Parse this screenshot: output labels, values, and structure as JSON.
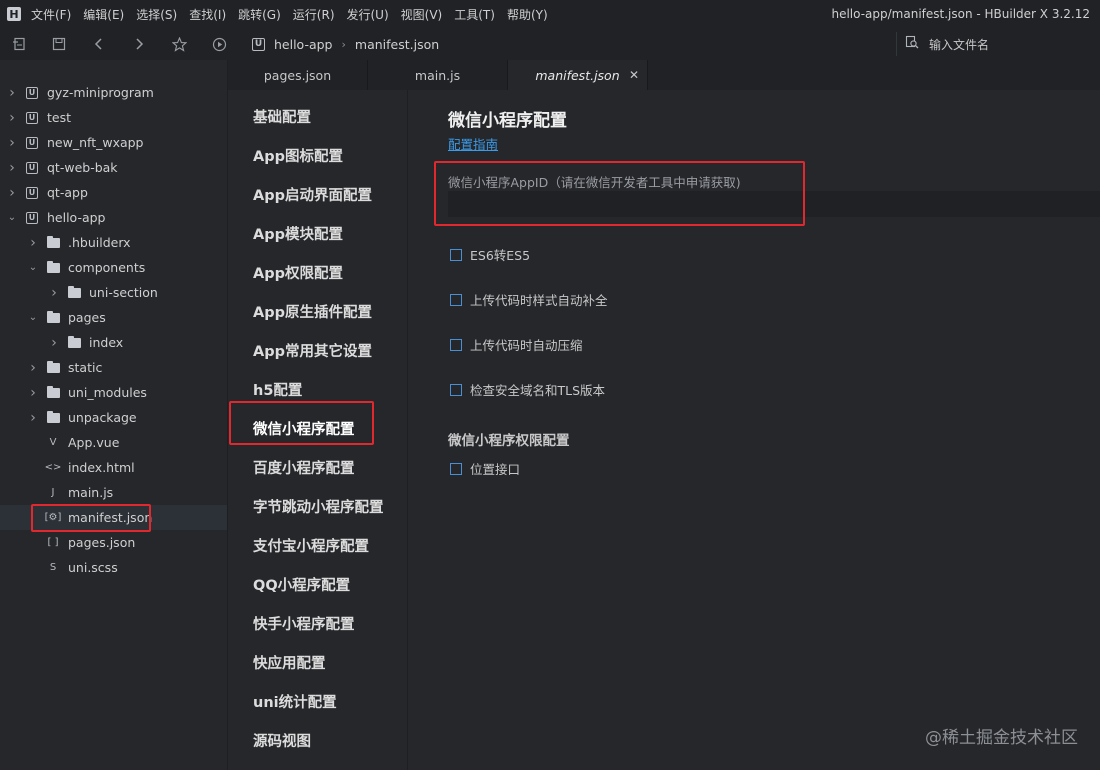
{
  "app": {
    "logo_letter": "H",
    "window_title": "hello-app/manifest.json - HBuilder X 3.2.12"
  },
  "menu": [
    "文件(F)",
    "编辑(E)",
    "选择(S)",
    "查找(I)",
    "跳转(G)",
    "运行(R)",
    "发行(U)",
    "视图(V)",
    "工具(T)",
    "帮助(Y)"
  ],
  "toolbar": {
    "breadcrumb": [
      "hello-app",
      "manifest.json"
    ],
    "project_badge": "U",
    "search_placeholder": "输入文件名"
  },
  "tree": [
    {
      "label": "gyz-miniprogram",
      "type": "project",
      "level": 0,
      "expanded": false
    },
    {
      "label": "test",
      "type": "project",
      "level": 0,
      "expanded": false
    },
    {
      "label": "new_nft_wxapp",
      "type": "project",
      "level": 0,
      "expanded": false
    },
    {
      "label": "qt-web-bak",
      "type": "project",
      "level": 0,
      "expanded": false
    },
    {
      "label": "qt-app",
      "type": "project",
      "level": 0,
      "expanded": false
    },
    {
      "label": "hello-app",
      "type": "project",
      "level": 0,
      "expanded": true
    },
    {
      "label": ".hbuilderx",
      "type": "folder",
      "level": 1,
      "expanded": false
    },
    {
      "label": "components",
      "type": "folder",
      "level": 1,
      "expanded": true
    },
    {
      "label": "uni-section",
      "type": "folder",
      "level": 2,
      "expanded": false
    },
    {
      "label": "pages",
      "type": "folder",
      "level": 1,
      "expanded": true
    },
    {
      "label": "index",
      "type": "folder",
      "level": 2,
      "expanded": false
    },
    {
      "label": "static",
      "type": "folder",
      "level": 1,
      "expanded": false
    },
    {
      "label": "uni_modules",
      "type": "folder",
      "level": 1,
      "expanded": false
    },
    {
      "label": "unpackage",
      "type": "folder",
      "level": 1,
      "expanded": false
    },
    {
      "label": "App.vue",
      "type": "vue",
      "level": 1,
      "expanded": null
    },
    {
      "label": "index.html",
      "type": "html",
      "level": 1,
      "expanded": null
    },
    {
      "label": "main.js",
      "type": "js",
      "level": 1,
      "expanded": null
    },
    {
      "label": "manifest.json",
      "type": "manifest",
      "level": 1,
      "expanded": null,
      "selected": true
    },
    {
      "label": "pages.json",
      "type": "json",
      "level": 1,
      "expanded": null
    },
    {
      "label": "uni.scss",
      "type": "scss",
      "level": 1,
      "expanded": null
    }
  ],
  "tabs": [
    {
      "label": "pages.json",
      "active": false
    },
    {
      "label": "main.js",
      "active": false
    },
    {
      "label": "manifest.json",
      "active": true
    }
  ],
  "config_nav": [
    "基础配置",
    "App图标配置",
    "App启动界面配置",
    "App模块配置",
    "App权限配置",
    "App原生插件配置",
    "App常用其它设置",
    "h5配置",
    "微信小程序配置",
    "百度小程序配置",
    "字节跳动小程序配置",
    "支付宝小程序配置",
    "QQ小程序配置",
    "快手小程序配置",
    "快应用配置",
    "uni统计配置",
    "源码视图"
  ],
  "config_nav_active_index": 8,
  "main": {
    "title": "微信小程序配置",
    "guide_link": "配置指南",
    "appid_label": "微信小程序AppID（请在微信开发者工具中申请获取)",
    "appid_value": "",
    "options": [
      "ES6转ES5",
      "上传代码时样式自动补全",
      "上传代码时自动压缩",
      "检查安全域名和TLS版本"
    ],
    "permission_section": "微信小程序权限配置",
    "permission_options": [
      "位置接口"
    ]
  },
  "colors": {
    "highlight": "#e0282e",
    "link": "#3c9be8",
    "checkbox_border": "#4a8fd4"
  },
  "watermark": "@稀土掘金技术社区"
}
